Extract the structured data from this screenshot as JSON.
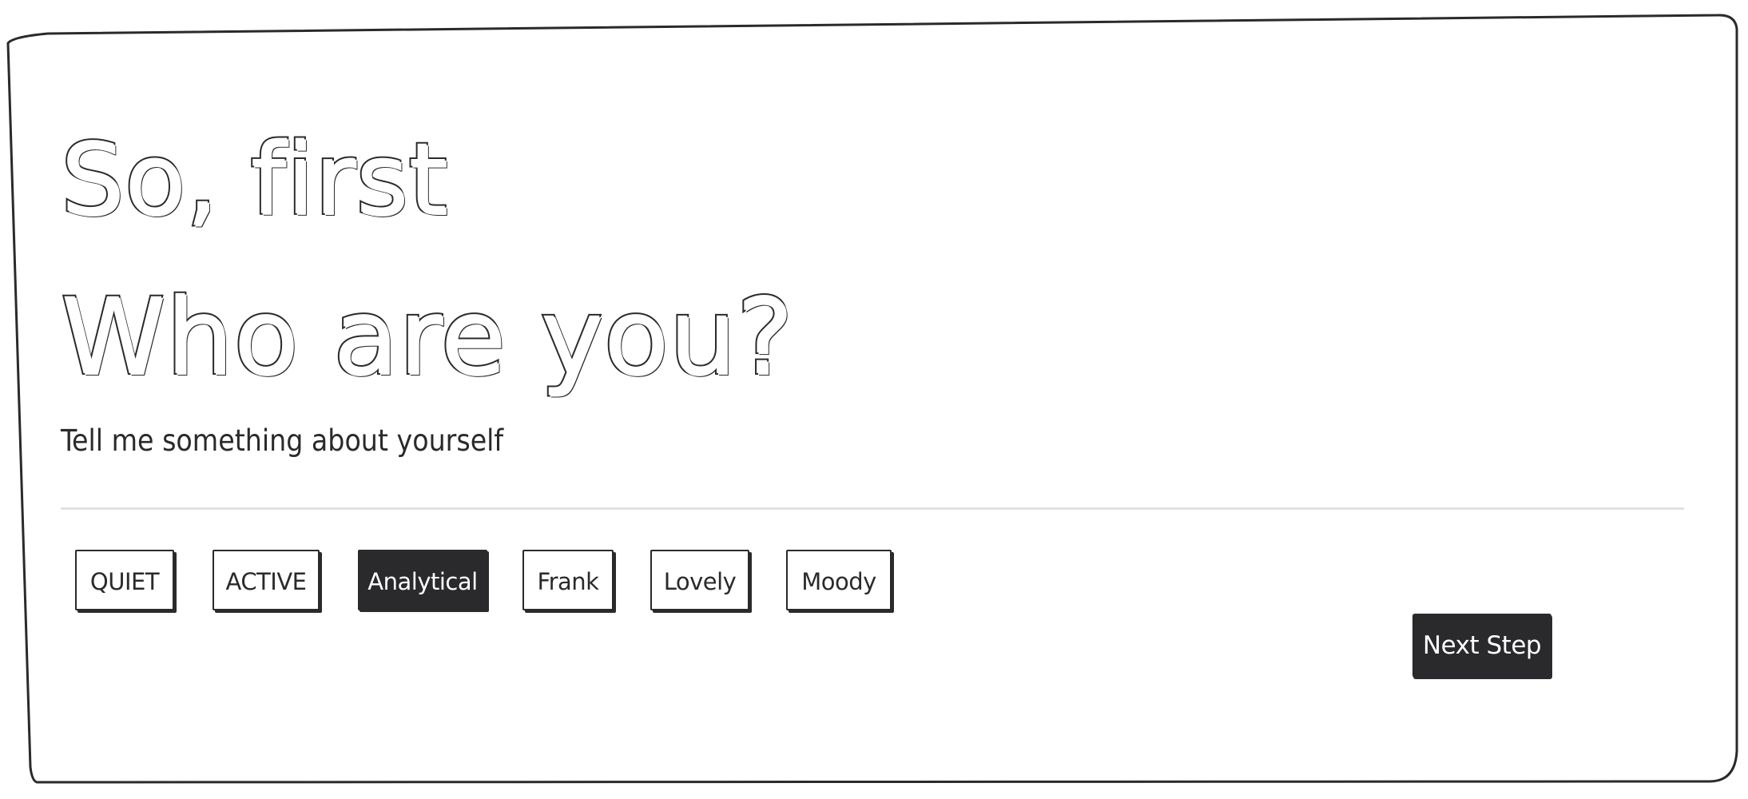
{
  "heading": {
    "line1": "So, first",
    "line2": "Who are you?"
  },
  "subtitle": "Tell me something about yourself",
  "tags": [
    {
      "label": "QUIET",
      "selected": false
    },
    {
      "label": "ACTIVE",
      "selected": false
    },
    {
      "label": "Analytical",
      "selected": true
    },
    {
      "label": "Frank",
      "selected": false
    },
    {
      "label": "Lovely",
      "selected": false
    },
    {
      "label": "Moody",
      "selected": false
    }
  ],
  "next_button": {
    "label": "Next Step"
  },
  "colors": {
    "ink": "#2a2a2c",
    "paper": "#ffffff",
    "divider": "#e2e2e2"
  }
}
